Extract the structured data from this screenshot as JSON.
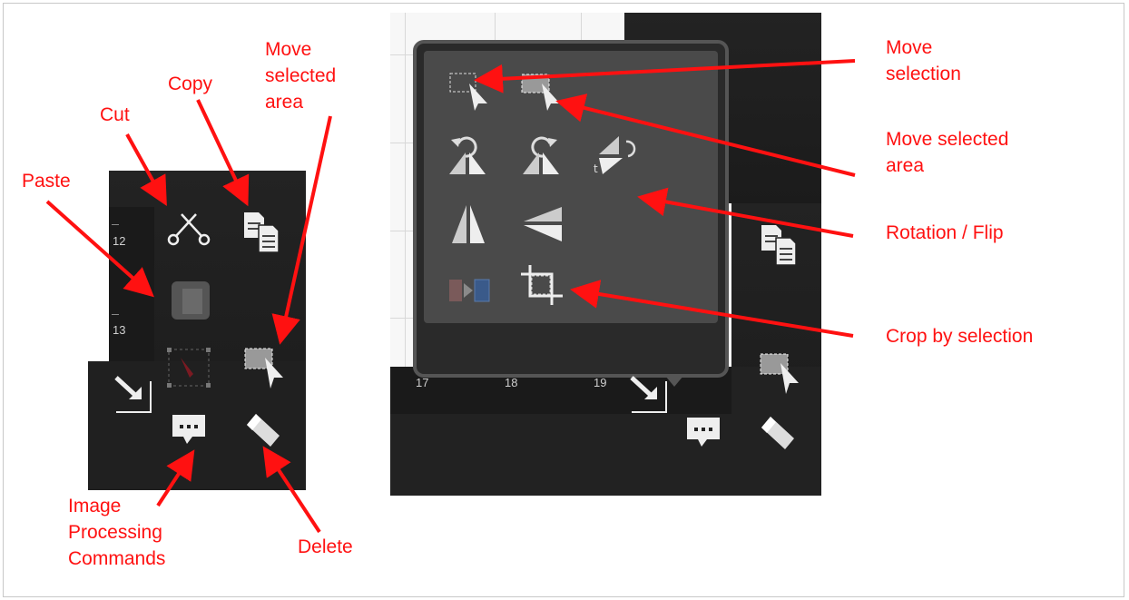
{
  "annotations": {
    "paste": "Paste",
    "cut": "Cut",
    "copy": "Copy",
    "move_selected_area": [
      "Move",
      "selected",
      "area"
    ],
    "image_processing": [
      "Image",
      "Processing",
      "Commands"
    ],
    "delete": "Delete",
    "move_selection": [
      "Move",
      "selection"
    ],
    "move_selected_area_right": [
      "Move selected",
      "area"
    ],
    "rotation_flip": "Rotation / Flip",
    "crop_by_selection": "Crop by selection"
  },
  "left_panel": {
    "ruler": [
      "12",
      "13"
    ]
  },
  "right_panel": {
    "ruler": [
      "17",
      "18",
      "19"
    ]
  },
  "icons": {
    "scissors": "scissors-icon",
    "copy": "copy-icon",
    "paste": "paste-icon",
    "move_area": "move-selected-area-icon",
    "image_processing": "speech-bubble-icon",
    "delete": "eraser-icon",
    "move_selection": "move-selection-icon",
    "rotate_left": "rotate-left-icon",
    "rotate_right": "rotate-right-icon",
    "rotate_free": "free-rotate-icon",
    "flip_h": "flip-horizontal-icon",
    "flip_v": "flip-vertical-icon",
    "resize": "resize-icon",
    "crop": "crop-icon"
  },
  "colors": {
    "annotation": "#ff1111",
    "panel": "#1f1f1f",
    "popup": "#4a4a4a"
  }
}
